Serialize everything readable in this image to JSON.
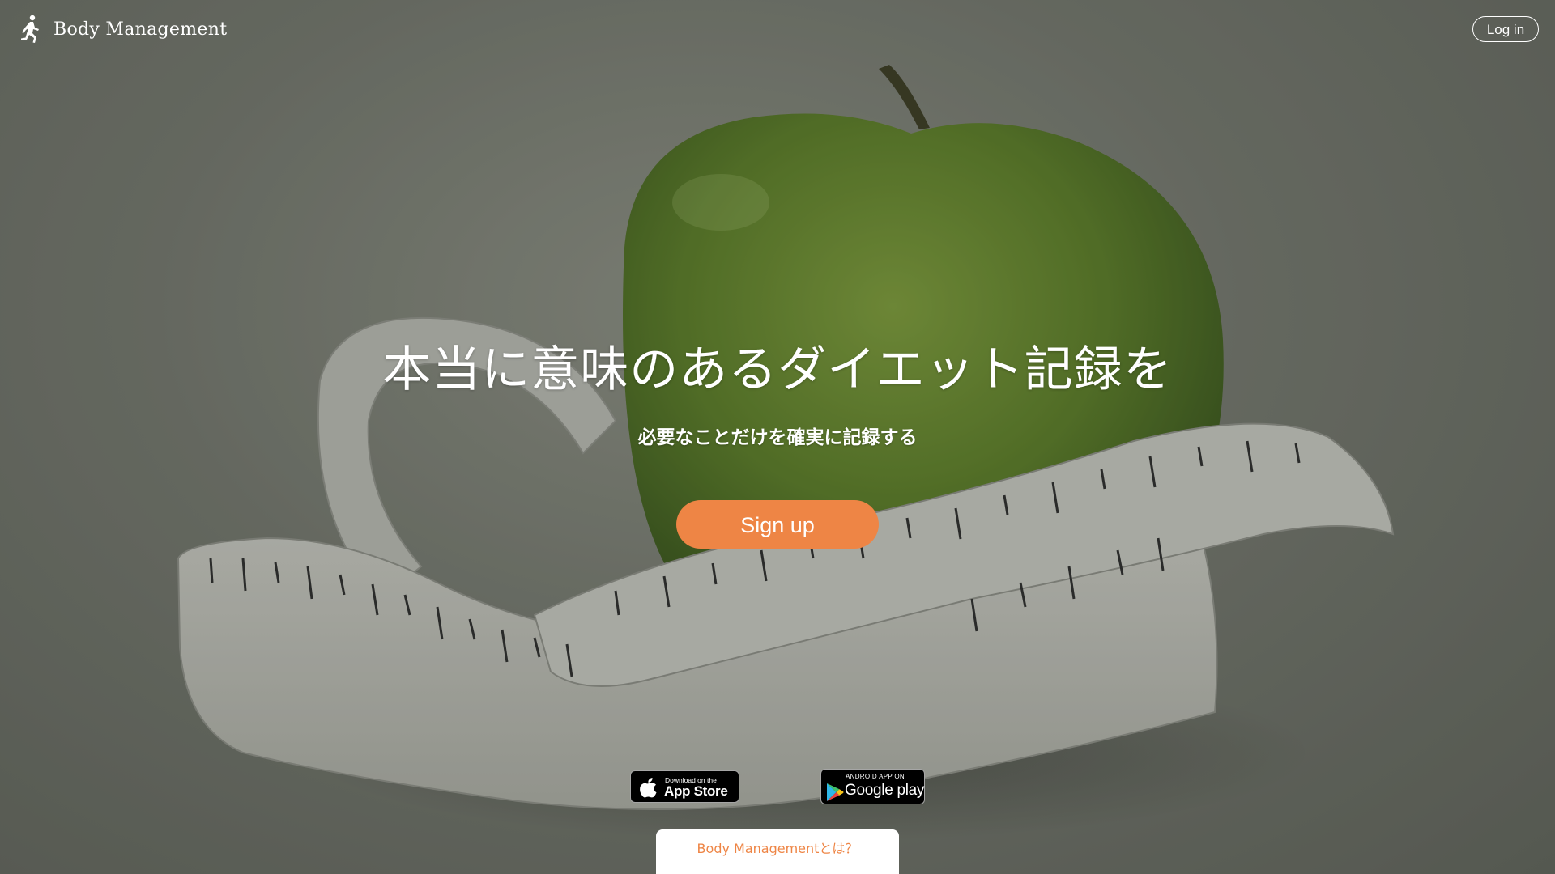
{
  "header": {
    "brand_name": "Body Management",
    "brand_icon": "runner-icon",
    "login_label": "Log in"
  },
  "hero": {
    "headline": "本当に意味のあるダイエット記録を",
    "subheadline": "必要なことだけを確実に記録する",
    "signup_label": "Sign up",
    "background_image": "green apple wrapped with measuring tape"
  },
  "badges": {
    "apple": {
      "small_text": "Download on the",
      "big_text": "App Store",
      "icon": "apple-icon"
    },
    "google": {
      "small_text": "ANDROID APP ON",
      "big_text": "Google play",
      "icon": "google-play-icon"
    }
  },
  "footer": {
    "about_label": "Body Managementとは？"
  },
  "colors": {
    "accent": "#ee8545",
    "text_on_hero": "#ffffff"
  }
}
